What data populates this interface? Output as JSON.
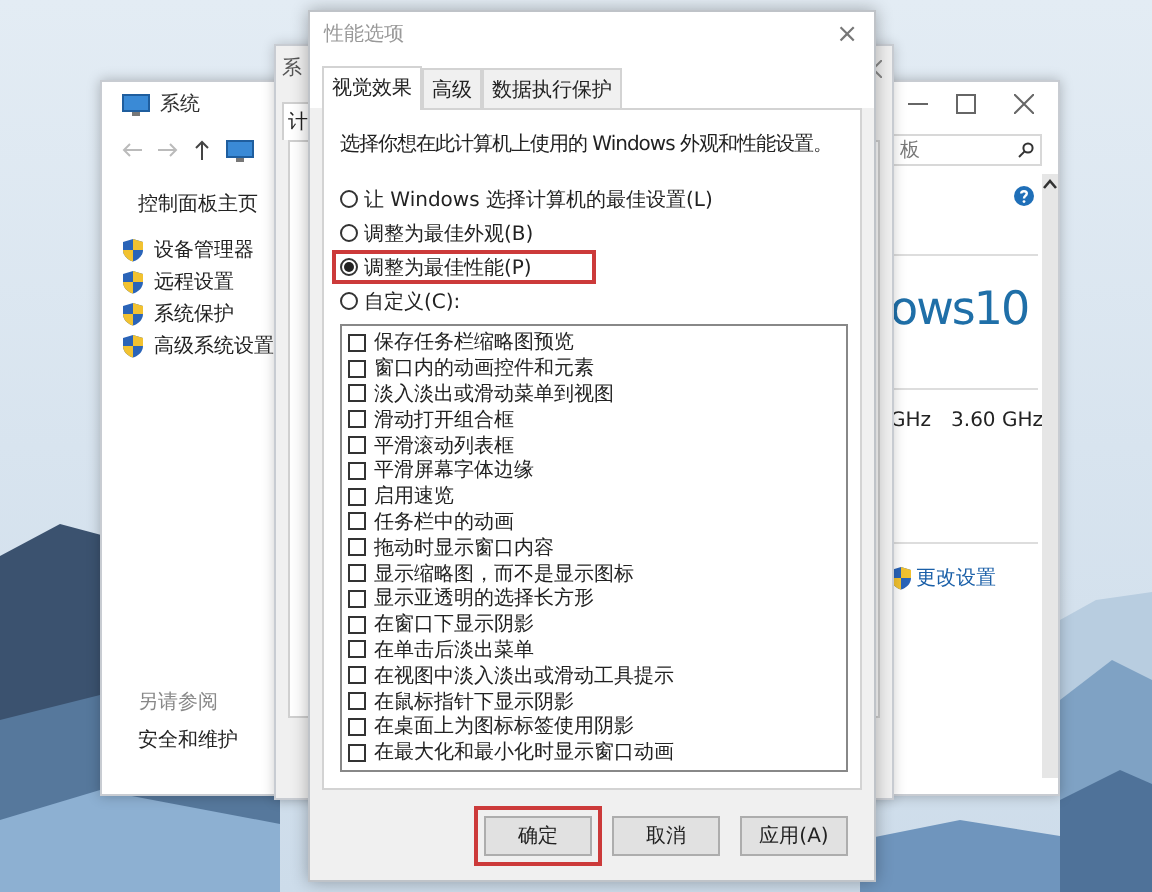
{
  "control_panel_window": {
    "title": "系统",
    "search": {
      "placeholder": "板"
    },
    "sidebar": {
      "home": "控制面板主页",
      "items": [
        "设备管理器",
        "远程设置",
        "系统保护",
        "高级系统设置"
      ],
      "see_also_heading": "另请参阅",
      "see_also_items": [
        "安全和维护"
      ]
    },
    "edition_text": "ows10",
    "processor_speed": "GHz",
    "processor_speed_2": "3.60 GHz",
    "change_settings_link": "更改设置"
  },
  "properties_window": {
    "title": "系",
    "tab": "计"
  },
  "dialog": {
    "title": "性能选项",
    "close": "×",
    "tabs": [
      {
        "label": "视觉效果",
        "selected": true
      },
      {
        "label": "高级",
        "selected": false
      },
      {
        "label": "数据执行保护",
        "selected": false
      }
    ],
    "description": "选择你想在此计算机上使用的 Windows 外观和性能设置。",
    "options": [
      {
        "label": "让 Windows 选择计算机的最佳设置(L)",
        "selected": false,
        "highlighted": false
      },
      {
        "label": "调整为最佳外观(B)",
        "selected": false,
        "highlighted": false
      },
      {
        "label": "调整为最佳性能(P)",
        "selected": true,
        "highlighted": true
      },
      {
        "label": "自定义(C):",
        "selected": false,
        "highlighted": false
      }
    ],
    "effects": [
      {
        "label": "保存任务栏缩略图预览",
        "checked": false
      },
      {
        "label": "窗口内的动画控件和元素",
        "checked": false
      },
      {
        "label": "淡入淡出或滑动菜单到视图",
        "checked": false
      },
      {
        "label": "滑动打开组合框",
        "checked": false
      },
      {
        "label": "平滑滚动列表框",
        "checked": false
      },
      {
        "label": "平滑屏幕字体边缘",
        "checked": false
      },
      {
        "label": "启用速览",
        "checked": false
      },
      {
        "label": "任务栏中的动画",
        "checked": false
      },
      {
        "label": "拖动时显示窗口内容",
        "checked": false
      },
      {
        "label": "显示缩略图，而不是显示图标",
        "checked": false
      },
      {
        "label": "显示亚透明的选择长方形",
        "checked": false
      },
      {
        "label": "在窗口下显示阴影",
        "checked": false
      },
      {
        "label": "在单击后淡出菜单",
        "checked": false
      },
      {
        "label": "在视图中淡入淡出或滑动工具提示",
        "checked": false
      },
      {
        "label": "在鼠标指针下显示阴影",
        "checked": false
      },
      {
        "label": "在桌面上为图标标签使用阴影",
        "checked": false
      },
      {
        "label": "在最大化和最小化时显示窗口动画",
        "checked": false
      }
    ],
    "buttons": [
      {
        "label": "确定",
        "highlighted": true
      },
      {
        "label": "取消",
        "highlighted": false
      },
      {
        "label": "应用(A)",
        "highlighted": false
      }
    ]
  }
}
